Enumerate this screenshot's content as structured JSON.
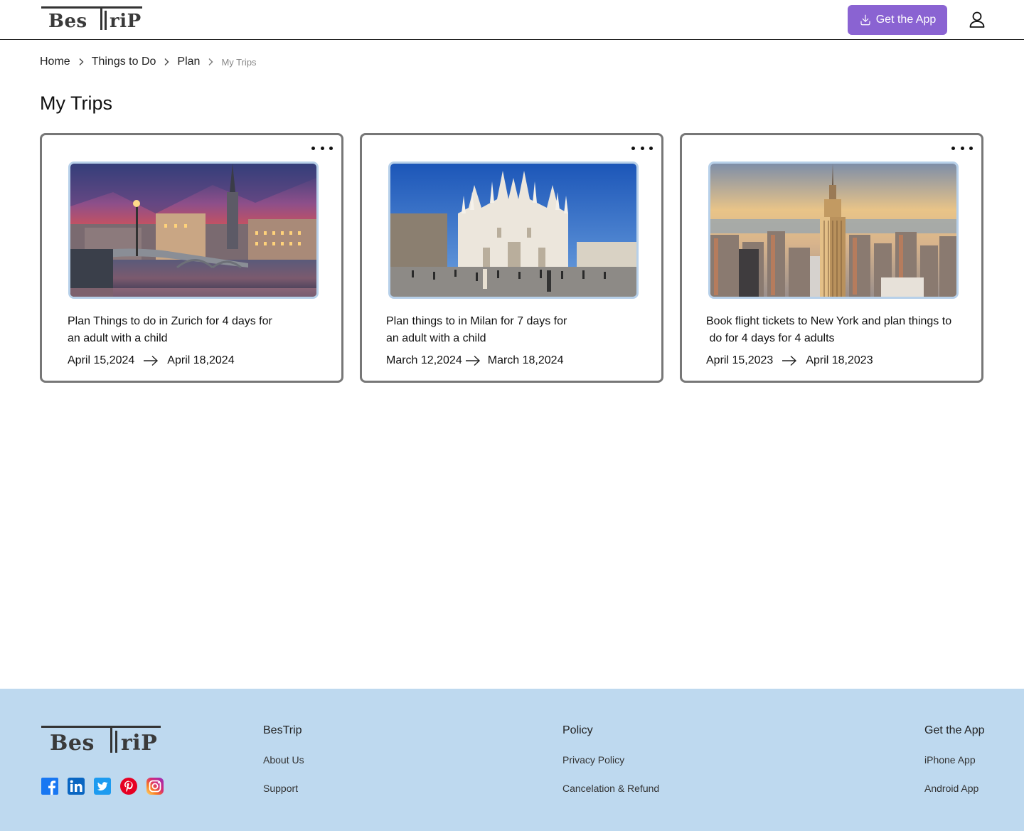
{
  "brand": {
    "logo_text": "BesTriP",
    "logo_left": "Bes",
    "logo_right": "riP"
  },
  "header": {
    "get_app_label": "Get the App",
    "accent": "#8a63d2"
  },
  "breadcrumb": {
    "items": [
      "Home",
      "Things to Do",
      "Plan"
    ],
    "current": "My Trips"
  },
  "page": {
    "title": "My Trips"
  },
  "trips": [
    {
      "title_line1": "Plan Things to do in Zurich for 4 days for",
      "title_line2": "an adult with a child",
      "start": "April 15,2024",
      "end": "April 18,2024",
      "image": "zurich-sunset-photo"
    },
    {
      "title_line1": "Plan things to in Milan for 7 days for",
      "title_line2": "an adult with a child",
      "start": "March 12,2024",
      "end": "March 18,2024",
      "image": "milan-cathedral-photo"
    },
    {
      "title_line1": "Book flight tickets to New York and plan things to",
      "title_line2": " do for 4 days for 4 adults",
      "start": "April 15,2023",
      "end": "April 18,2023",
      "image": "new-york-empire-state-photo"
    }
  ],
  "footer": {
    "background": "#bed9ef",
    "col1": {
      "heading": "BesTrip",
      "links": [
        "About Us",
        "Support"
      ]
    },
    "col2": {
      "heading": "Policy",
      "links": [
        "Privacy Policy",
        "Cancelation & Refund"
      ]
    },
    "col3": {
      "heading": "Get the App",
      "links": [
        "iPhone App",
        "Android App"
      ]
    },
    "socials": [
      "facebook-icon",
      "linkedin-icon",
      "twitter-icon",
      "pinterest-icon",
      "instagram-icon"
    ]
  }
}
